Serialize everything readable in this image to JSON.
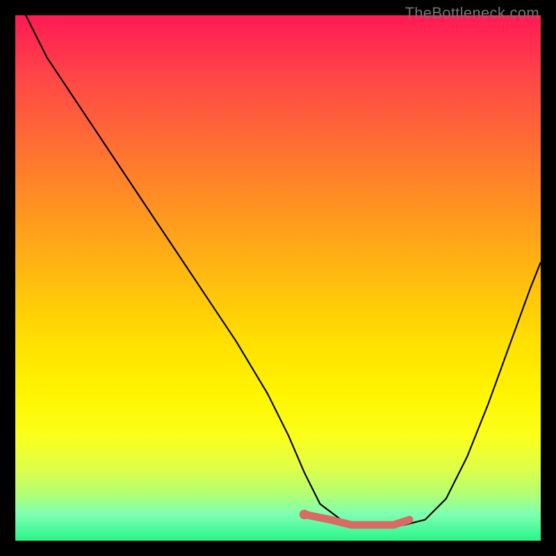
{
  "watermark": "TheBottleneck.com",
  "colors": {
    "curve_stroke": "#000000",
    "marker_stroke": "#d96a64",
    "marker_fill": "#d96a64",
    "background": "#000000"
  },
  "chart_data": {
    "type": "line",
    "title": "",
    "xlabel": "",
    "ylabel": "",
    "xlim": [
      0,
      100
    ],
    "ylim": [
      0,
      100
    ],
    "series": [
      {
        "name": "bottleneck-curve",
        "x": [
          2,
          6,
          12,
          18,
          24,
          30,
          36,
          42,
          48,
          52,
          55,
          58,
          62,
          66,
          70,
          74,
          78,
          82,
          86,
          90,
          94,
          98,
          100
        ],
        "values": [
          100,
          92,
          83,
          74,
          65,
          56,
          47,
          38,
          28,
          20,
          13,
          7,
          4,
          3,
          3,
          3,
          4,
          8,
          16,
          26,
          37,
          48,
          53
        ]
      }
    ],
    "markers": {
      "name": "highlight-range",
      "x": [
        55,
        60,
        64,
        68,
        72,
        75
      ],
      "values": [
        5,
        4,
        3,
        3,
        3,
        4
      ]
    }
  }
}
